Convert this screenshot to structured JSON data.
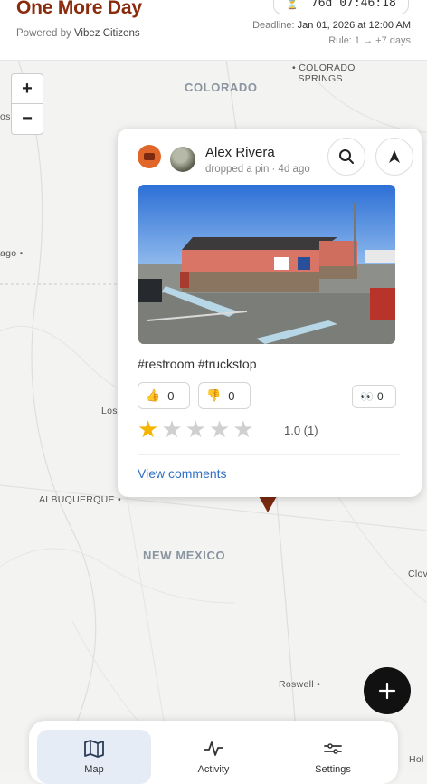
{
  "header": {
    "app_title": "One More Day",
    "powered_prefix": "Powered by",
    "powered_brand": "Vibez Citizens",
    "timer": "76d 07:46:18",
    "timer_icon": "hourglass-icon",
    "deadline_label": "Deadline:",
    "deadline_value": "Jan 01, 2026 at 12:00 AM",
    "rule": "Rule: 1 → +7 days"
  },
  "map": {
    "zoom_in": "+",
    "zoom_out": "−",
    "region_labels": {
      "colorado": "COLORADO",
      "new_mexico": "NEW MEXICO"
    },
    "cities": {
      "colorado_springs_line1": "COLORADO",
      "colorado_springs_line2": "SPRINGS",
      "albuquerque": "ALBUQUERQUE",
      "roswell": "Roswell",
      "ose": "ose",
      "ago": "ago",
      "los": "Los",
      "clov": "Clov",
      "hol": "Hol"
    }
  },
  "popup": {
    "user_name": "Alex Rivera",
    "user_meta": "dropped a pin · 4d ago",
    "tags": "#restroom #truckstop",
    "thumbs_up_count": "0",
    "thumbs_down_count": "0",
    "eyes_count": "0",
    "rating": 1,
    "rating_max": 5,
    "rating_text": "1.0 (1)",
    "view_comments": "View comments"
  },
  "nav": {
    "items": [
      {
        "label": "Map",
        "icon": "map-icon",
        "active": true
      },
      {
        "label": "Activity",
        "icon": "activity-icon",
        "active": false
      },
      {
        "label": "Settings",
        "icon": "settings-icon",
        "active": false
      }
    ]
  },
  "colors": {
    "brand": "#8b2b0e",
    "link": "#2f6fc4",
    "star": "#f5b400",
    "active_nav": "#e6ecf6"
  }
}
